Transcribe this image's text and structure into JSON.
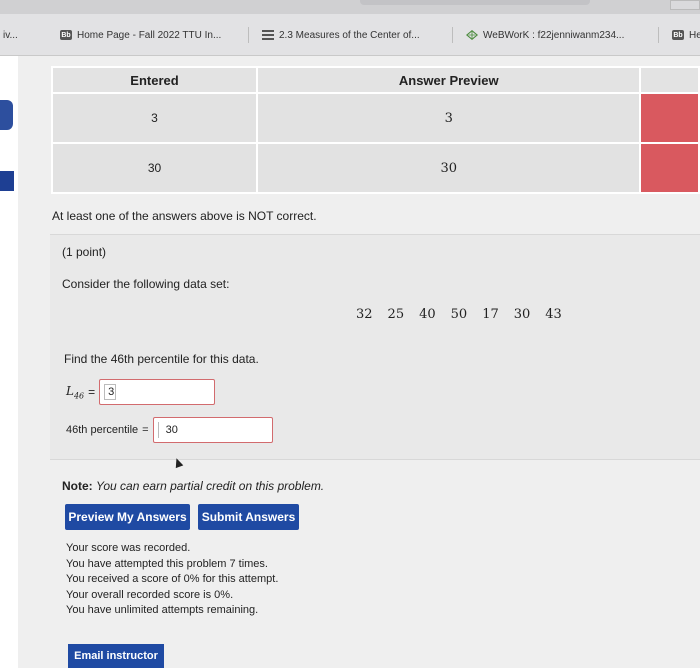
{
  "tabs": [
    {
      "label": "iv...",
      "icon": "",
      "icon_text": ""
    },
    {
      "label": "Home Page - Fall 2022 TTU In...",
      "icon": "blackboard-icon",
      "icon_text": "Bb"
    },
    {
      "label": "2.3 Measures of the Center of...",
      "icon": "stack-icon",
      "icon_text": ""
    },
    {
      "label": "WeBWorK : f22jenniwanm234...",
      "icon": "webwork-icon",
      "icon_text": ""
    },
    {
      "label": "He",
      "icon": "blackboard-icon",
      "icon_text": "Bb"
    }
  ],
  "answers_table": {
    "headers": [
      "Entered",
      "Answer Preview",
      ""
    ],
    "rows": [
      {
        "entered": "3",
        "preview": "3",
        "status_color": "#d9595f"
      },
      {
        "entered": "30",
        "preview": "30",
        "status_color": "#d9595f"
      }
    ]
  },
  "status_message": "At least one of the answers above is NOT correct.",
  "problem": {
    "points": "(1 point)",
    "prompt": "Consider the following data set:",
    "data": [
      "32",
      "25",
      "40",
      "50",
      "17",
      "30",
      "43"
    ],
    "question": "Find the 46th percentile for this data.",
    "l_label": "L",
    "l_subscript": "46",
    "equals": "=",
    "l_value": "3",
    "percentile_label": "46th percentile",
    "percentile_value": "30"
  },
  "note": {
    "bold": "Note:",
    "italic": "You can earn partial credit on this problem."
  },
  "buttons": {
    "preview": "Preview My Answers",
    "submit": "Submit Answers",
    "email": "Email instructor"
  },
  "score_lines": [
    "Your score was recorded.",
    "You have attempted this problem 7 times.",
    "You received a score of 0% for this attempt.",
    "Your overall recorded score is 0%.",
    "You have unlimited attempts remaining."
  ]
}
